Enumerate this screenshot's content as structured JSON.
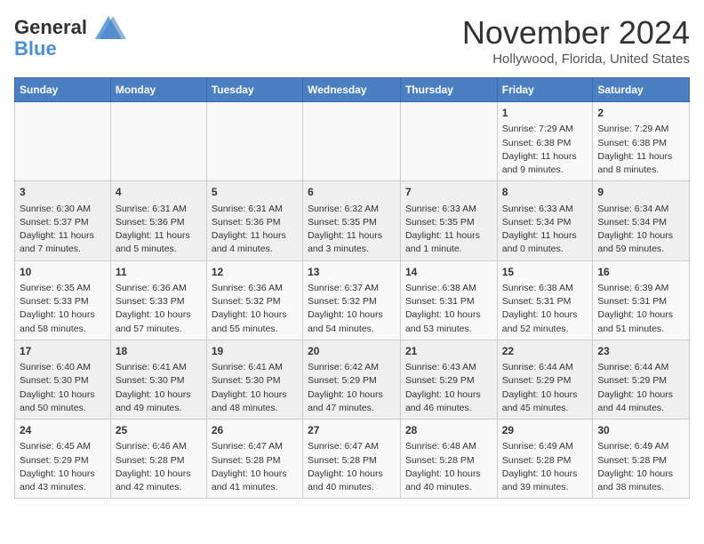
{
  "header": {
    "logo_line1": "General",
    "logo_line2": "Blue",
    "month": "November 2024",
    "location": "Hollywood, Florida, United States"
  },
  "weekdays": [
    "Sunday",
    "Monday",
    "Tuesday",
    "Wednesday",
    "Thursday",
    "Friday",
    "Saturday"
  ],
  "weeks": [
    [
      {
        "day": "",
        "text": ""
      },
      {
        "day": "",
        "text": ""
      },
      {
        "day": "",
        "text": ""
      },
      {
        "day": "",
        "text": ""
      },
      {
        "day": "",
        "text": ""
      },
      {
        "day": "1",
        "text": "Sunrise: 7:29 AM\nSunset: 6:38 PM\nDaylight: 11 hours and 9 minutes."
      },
      {
        "day": "2",
        "text": "Sunrise: 7:29 AM\nSunset: 6:38 PM\nDaylight: 11 hours and 8 minutes."
      }
    ],
    [
      {
        "day": "3",
        "text": "Sunrise: 6:30 AM\nSunset: 5:37 PM\nDaylight: 11 hours and 7 minutes."
      },
      {
        "day": "4",
        "text": "Sunrise: 6:31 AM\nSunset: 5:36 PM\nDaylight: 11 hours and 5 minutes."
      },
      {
        "day": "5",
        "text": "Sunrise: 6:31 AM\nSunset: 5:36 PM\nDaylight: 11 hours and 4 minutes."
      },
      {
        "day": "6",
        "text": "Sunrise: 6:32 AM\nSunset: 5:35 PM\nDaylight: 11 hours and 3 minutes."
      },
      {
        "day": "7",
        "text": "Sunrise: 6:33 AM\nSunset: 5:35 PM\nDaylight: 11 hours and 1 minute."
      },
      {
        "day": "8",
        "text": "Sunrise: 6:33 AM\nSunset: 5:34 PM\nDaylight: 11 hours and 0 minutes."
      },
      {
        "day": "9",
        "text": "Sunrise: 6:34 AM\nSunset: 5:34 PM\nDaylight: 10 hours and 59 minutes."
      }
    ],
    [
      {
        "day": "10",
        "text": "Sunrise: 6:35 AM\nSunset: 5:33 PM\nDaylight: 10 hours and 58 minutes."
      },
      {
        "day": "11",
        "text": "Sunrise: 6:36 AM\nSunset: 5:33 PM\nDaylight: 10 hours and 57 minutes."
      },
      {
        "day": "12",
        "text": "Sunrise: 6:36 AM\nSunset: 5:32 PM\nDaylight: 10 hours and 55 minutes."
      },
      {
        "day": "13",
        "text": "Sunrise: 6:37 AM\nSunset: 5:32 PM\nDaylight: 10 hours and 54 minutes."
      },
      {
        "day": "14",
        "text": "Sunrise: 6:38 AM\nSunset: 5:31 PM\nDaylight: 10 hours and 53 minutes."
      },
      {
        "day": "15",
        "text": "Sunrise: 6:38 AM\nSunset: 5:31 PM\nDaylight: 10 hours and 52 minutes."
      },
      {
        "day": "16",
        "text": "Sunrise: 6:39 AM\nSunset: 5:31 PM\nDaylight: 10 hours and 51 minutes."
      }
    ],
    [
      {
        "day": "17",
        "text": "Sunrise: 6:40 AM\nSunset: 5:30 PM\nDaylight: 10 hours and 50 minutes."
      },
      {
        "day": "18",
        "text": "Sunrise: 6:41 AM\nSunset: 5:30 PM\nDaylight: 10 hours and 49 minutes."
      },
      {
        "day": "19",
        "text": "Sunrise: 6:41 AM\nSunset: 5:30 PM\nDaylight: 10 hours and 48 minutes."
      },
      {
        "day": "20",
        "text": "Sunrise: 6:42 AM\nSunset: 5:29 PM\nDaylight: 10 hours and 47 minutes."
      },
      {
        "day": "21",
        "text": "Sunrise: 6:43 AM\nSunset: 5:29 PM\nDaylight: 10 hours and 46 minutes."
      },
      {
        "day": "22",
        "text": "Sunrise: 6:44 AM\nSunset: 5:29 PM\nDaylight: 10 hours and 45 minutes."
      },
      {
        "day": "23",
        "text": "Sunrise: 6:44 AM\nSunset: 5:29 PM\nDaylight: 10 hours and 44 minutes."
      }
    ],
    [
      {
        "day": "24",
        "text": "Sunrise: 6:45 AM\nSunset: 5:29 PM\nDaylight: 10 hours and 43 minutes."
      },
      {
        "day": "25",
        "text": "Sunrise: 6:46 AM\nSunset: 5:28 PM\nDaylight: 10 hours and 42 minutes."
      },
      {
        "day": "26",
        "text": "Sunrise: 6:47 AM\nSunset: 5:28 PM\nDaylight: 10 hours and 41 minutes."
      },
      {
        "day": "27",
        "text": "Sunrise: 6:47 AM\nSunset: 5:28 PM\nDaylight: 10 hours and 40 minutes."
      },
      {
        "day": "28",
        "text": "Sunrise: 6:48 AM\nSunset: 5:28 PM\nDaylight: 10 hours and 40 minutes."
      },
      {
        "day": "29",
        "text": "Sunrise: 6:49 AM\nSunset: 5:28 PM\nDaylight: 10 hours and 39 minutes."
      },
      {
        "day": "30",
        "text": "Sunrise: 6:49 AM\nSunset: 5:28 PM\nDaylight: 10 hours and 38 minutes."
      }
    ]
  ]
}
